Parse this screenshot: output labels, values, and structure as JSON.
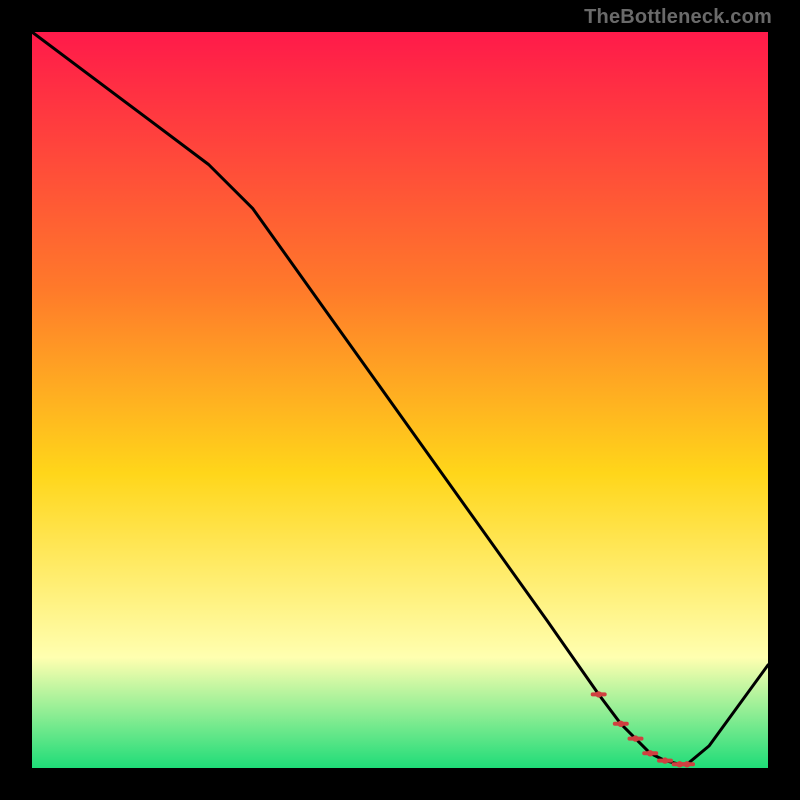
{
  "watermark": "TheBottleneck.com",
  "chart_data": {
    "type": "line",
    "title": "",
    "xlabel": "",
    "ylabel": "",
    "xlim": [
      0,
      100
    ],
    "ylim": [
      0,
      100
    ],
    "grid": false,
    "x": [
      0,
      8,
      16,
      24,
      30,
      40,
      50,
      60,
      70,
      77,
      80,
      82,
      84,
      86,
      88,
      89,
      92,
      100
    ],
    "values": [
      100,
      94,
      88,
      82,
      76,
      62,
      48,
      34,
      20,
      10,
      6,
      4,
      2,
      1,
      0.5,
      0.5,
      3,
      14
    ],
    "anomaly_region": {
      "x_from": 77,
      "x_to": 89
    },
    "colors": {
      "line": "#000000",
      "gradient_top": "#ff1a4a",
      "gradient_upper_mid": "#ff7a2a",
      "gradient_mid": "#ffd61a",
      "gradient_lower": "#ffffb0",
      "gradient_bottom": "#1fdc78",
      "anomaly_points": "#d04040",
      "background": "#000000"
    }
  }
}
